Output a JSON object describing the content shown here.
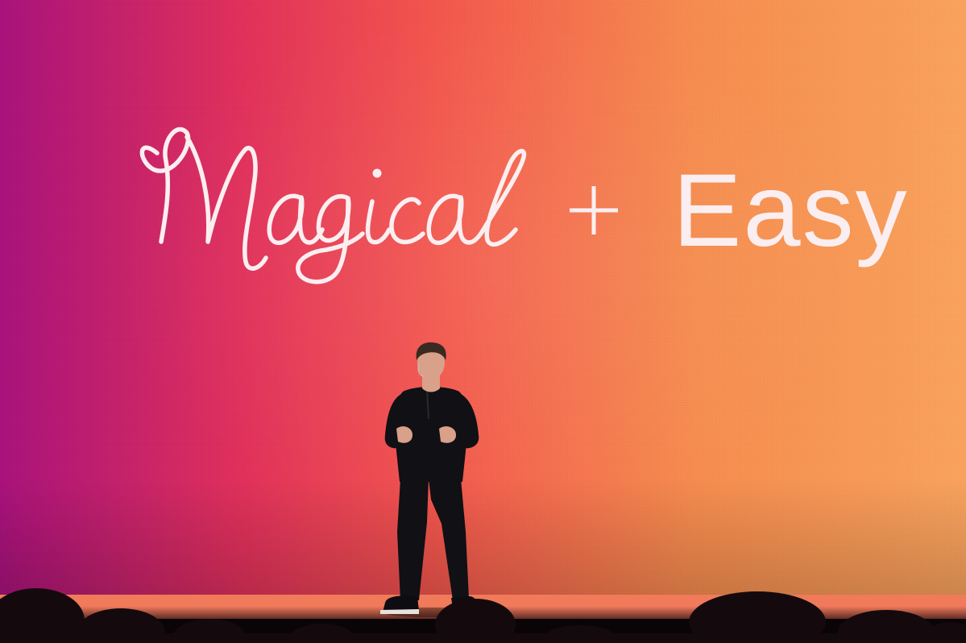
{
  "slide": {
    "script_word": "Magical",
    "plus_sign": "+",
    "sans_word": "Easy"
  },
  "colors": {
    "gradient_left": "#a8127a",
    "gradient_mid_left": "#e0305a",
    "gradient_mid": "#f2554c",
    "gradient_right": "#f58b4e",
    "gradient_far_right": "#f8a15c",
    "headline_color": "#fbeef0",
    "stage_floor": "#f07a5a",
    "speaker_clothing": "#111014",
    "speaker_skin": "#d9a08a",
    "speaker_hair": "#3a2a22",
    "audience_silhouette": "#140a0d"
  },
  "scene": {
    "speaker_outfit": "black henley shirt and dark trousers",
    "audience": "silhouetted heads in foreground"
  }
}
